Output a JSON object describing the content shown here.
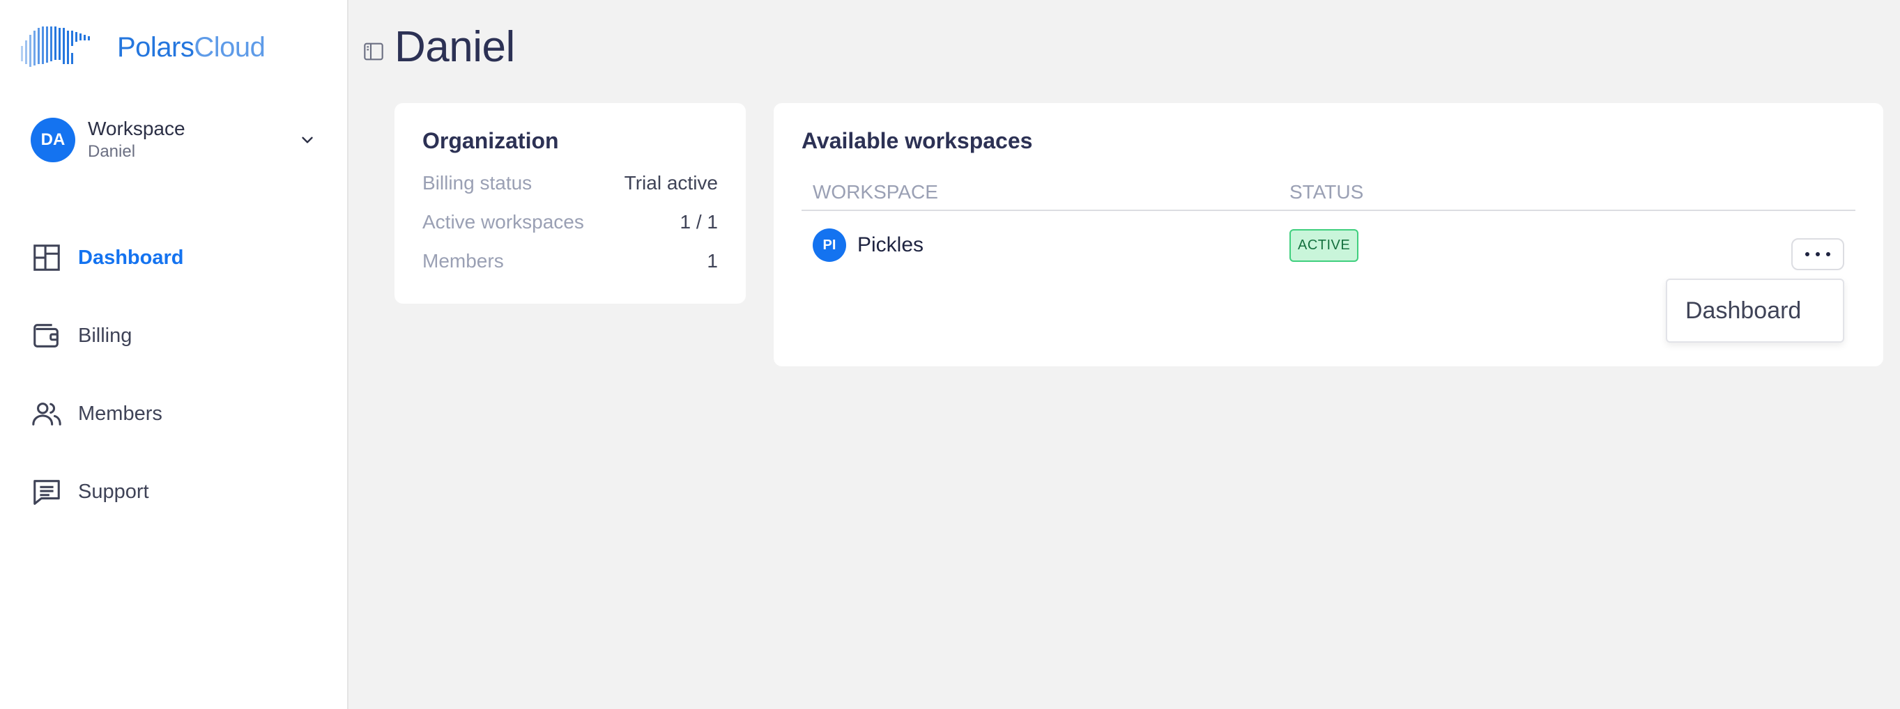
{
  "brand": {
    "name": "Polars",
    "suffix": "Cloud",
    "accent": "#1473f0"
  },
  "sidebar": {
    "workspace": {
      "initials": "DA",
      "label": "Workspace",
      "name": "Daniel"
    },
    "items": [
      {
        "label": "Dashboard",
        "icon": "dashboard-icon",
        "active": true
      },
      {
        "label": "Billing",
        "icon": "wallet-icon",
        "active": false
      },
      {
        "label": "Members",
        "icon": "members-icon",
        "active": false
      },
      {
        "label": "Support",
        "icon": "chat-icon",
        "active": false
      }
    ]
  },
  "page": {
    "title": "Daniel"
  },
  "organization": {
    "title": "Organization",
    "rows": [
      {
        "key": "Billing status",
        "value": "Trial active"
      },
      {
        "key": "Active workspaces",
        "value": "1 / 1"
      },
      {
        "key": "Members",
        "value": "1"
      }
    ]
  },
  "workspaces": {
    "title": "Available workspaces",
    "columns": {
      "workspace": "WORKSPACE",
      "status": "STATUS"
    },
    "rows": [
      {
        "initials": "PI",
        "name": "Pickles",
        "status": "ACTIVE"
      }
    ],
    "menu": {
      "items": [
        "Dashboard"
      ]
    }
  }
}
